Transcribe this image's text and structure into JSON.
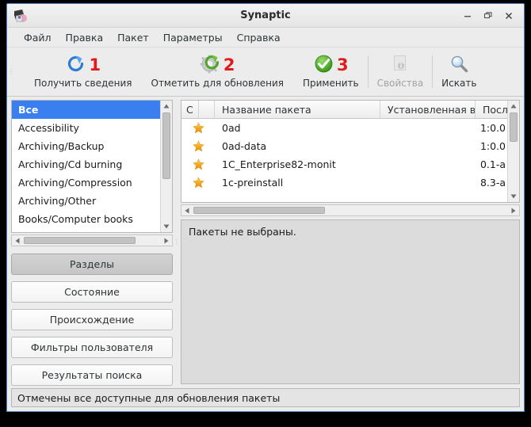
{
  "window": {
    "title": "Synaptic",
    "app_icon": "synaptic-package-icon",
    "controls": {
      "minimize": "−",
      "maximize": "❐",
      "close": "✕"
    }
  },
  "menubar": {
    "items": [
      {
        "label": "Файл",
        "name": "menu-file"
      },
      {
        "label": "Правка",
        "name": "menu-edit"
      },
      {
        "label": "Пакет",
        "name": "menu-package"
      },
      {
        "label": "Параметры",
        "name": "menu-settings"
      },
      {
        "label": "Справка",
        "name": "menu-help"
      }
    ]
  },
  "toolbar": {
    "items": [
      {
        "label": "Получить сведения",
        "badge": "1",
        "icon": "reload-icon",
        "disabled": false
      },
      {
        "label": "Отметить для обновления",
        "badge": "2",
        "icon": "mark-upgrades-icon",
        "disabled": false
      },
      {
        "label": "Применить",
        "badge": "3",
        "icon": "apply-check-icon",
        "disabled": false
      },
      {
        "label": "Свойства",
        "badge": "",
        "icon": "properties-info-icon",
        "disabled": true
      },
      {
        "label": "Искать",
        "badge": "",
        "icon": "search-magnifier-icon",
        "disabled": false
      }
    ]
  },
  "categories": {
    "items": [
      {
        "label": "Все",
        "selected": true
      },
      {
        "label": "Accessibility",
        "selected": false
      },
      {
        "label": "Archiving/Backup",
        "selected": false
      },
      {
        "label": "Archiving/Cd burning",
        "selected": false
      },
      {
        "label": "Archiving/Compression",
        "selected": false
      },
      {
        "label": "Archiving/Other",
        "selected": false
      },
      {
        "label": "Books/Computer books",
        "selected": false
      }
    ]
  },
  "filter_buttons": {
    "items": [
      {
        "label": "Разделы",
        "active": true
      },
      {
        "label": "Состояние",
        "active": false
      },
      {
        "label": "Происхождение",
        "active": false
      },
      {
        "label": "Фильтры пользователя",
        "active": false
      },
      {
        "label": "Результаты поиска",
        "active": false
      }
    ]
  },
  "package_list": {
    "columns": {
      "status": "С",
      "blank": "",
      "name": "Название пакета",
      "installed": "Установленная вер",
      "latest": "Посл"
    },
    "rows": [
      {
        "status_icon": "star-icon",
        "name": "0ad",
        "installed": "",
        "latest": "1:0.0"
      },
      {
        "status_icon": "star-icon",
        "name": "0ad-data",
        "installed": "",
        "latest": "1:0.0"
      },
      {
        "status_icon": "star-icon",
        "name": "1C_Enterprise82-monit",
        "installed": "",
        "latest": "0.1-a"
      },
      {
        "status_icon": "star-icon",
        "name": "1c-preinstall",
        "installed": "",
        "latest": "8.3-a"
      }
    ]
  },
  "description": {
    "text": "Пакеты не выбраны."
  },
  "statusbar": {
    "text": "Отмечены все доступные для обновления пакеты"
  },
  "colors": {
    "selection_blue": "#3a7ff0",
    "badge_red": "#e01b1b",
    "window_border": "#4a82c8",
    "chrome_bg": "#ececed",
    "star_gold": "#f0a01e"
  }
}
